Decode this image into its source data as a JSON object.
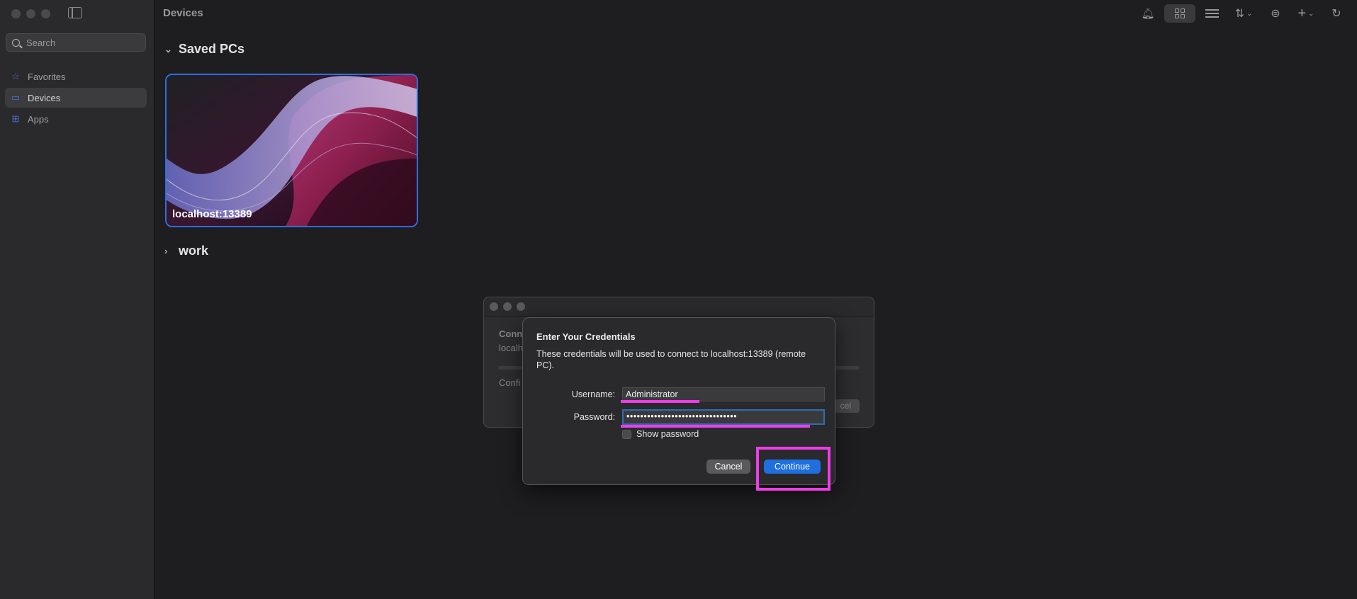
{
  "sidebar": {
    "search_placeholder": "Search",
    "items": [
      {
        "label": "Favorites",
        "icon": "star-icon",
        "active": false
      },
      {
        "label": "Devices",
        "icon": "monitor-icon",
        "active": true
      },
      {
        "label": "Apps",
        "icon": "grid-icon",
        "active": false
      }
    ]
  },
  "header": {
    "title": "Devices"
  },
  "sections": {
    "saved_pcs": "Saved PCs",
    "work": "work"
  },
  "pc_card": {
    "label": "localhost:13389"
  },
  "background_window": {
    "line1": "Conn",
    "line2": "localh",
    "line3": "Confi",
    "cancel": "cel"
  },
  "dialog": {
    "title": "Enter Your Credentials",
    "message": "These credentials will be used to connect to localhost:13389 (remote PC).",
    "username_label": "Username:",
    "username_value": "Administrator",
    "password_label": "Password:",
    "password_value": "••••••••••••••••••••••••••••••••",
    "show_password_label": "Show password",
    "cancel_label": "Cancel",
    "continue_label": "Continue"
  },
  "colors": {
    "accent": "#1f6fe0",
    "annotation": "#f03ce8"
  }
}
